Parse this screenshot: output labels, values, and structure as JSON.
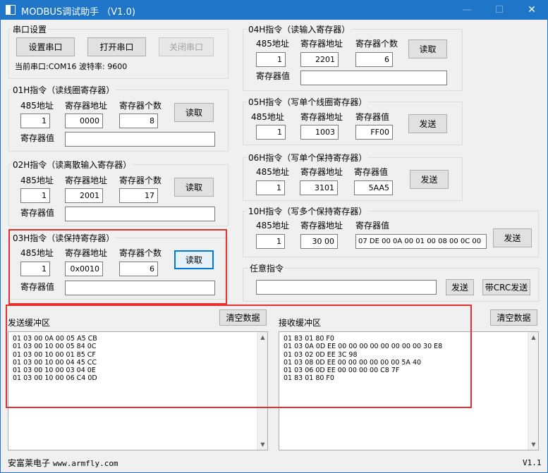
{
  "window": {
    "title": "MODBUS调试助手 （V1.0)",
    "minimize_glyph": "—",
    "maximize_glyph": "☐",
    "close_glyph": "✕"
  },
  "serial": {
    "group_label": "串口设置",
    "setup_button": "设置串口",
    "open_button": "打开串口",
    "close_button": "关闭串口",
    "status": "当前串口:COM16 波特率: 9600"
  },
  "cmd01": {
    "title": "01H指令（读线圈寄存器）",
    "addr_label": "485地址",
    "addr_value": "1",
    "reg_label": "寄存器地址",
    "reg_value": "0000",
    "count_label": "寄存器个数",
    "count_value": "8",
    "button": "读取",
    "value_label": "寄存器值",
    "value": ""
  },
  "cmd02": {
    "title": "02H指令（读离散输入寄存器）",
    "addr_label": "485地址",
    "addr_value": "1",
    "reg_label": "寄存器地址",
    "reg_value": "2001",
    "count_label": "寄存器个数",
    "count_value": "17",
    "button": "读取",
    "value_label": "寄存器值",
    "value": ""
  },
  "cmd03": {
    "title": "03H指令（读保持寄存器）",
    "addr_label": "485地址",
    "addr_value": "1",
    "reg_label": "寄存器地址",
    "reg_value": "0x0010",
    "count_label": "寄存器个数",
    "count_value": "6",
    "button": "读取",
    "value_label": "寄存器值",
    "value": ""
  },
  "cmd04": {
    "title": "04H指令（读输入寄存器）",
    "addr_label": "485地址",
    "addr_value": "1",
    "reg_label": "寄存器地址",
    "reg_value": "2201",
    "count_label": "寄存器个数",
    "count_value": "6",
    "button": "读取",
    "value_label": "寄存器值",
    "value": ""
  },
  "cmd05": {
    "title": "05H指令（写单个线圈寄存器）",
    "addr_label": "485地址",
    "addr_value": "1",
    "reg_label": "寄存器地址",
    "reg_value": "1003",
    "val_label": "寄存器值",
    "val_value": "FF00",
    "button": "发送"
  },
  "cmd06": {
    "title": "06H指令（写单个保持寄存器）",
    "addr_label": "485地址",
    "addr_value": "1",
    "reg_label": "寄存器地址",
    "reg_value": "3101",
    "val_label": "寄存器值",
    "val_value": "5AA5",
    "button": "发送"
  },
  "cmd10": {
    "title": "10H指令（写多个保持寄存器）",
    "addr_label": "485地址",
    "addr_value": "1",
    "reg_label": "寄存器地址",
    "reg_value": "30 00",
    "val_label": "寄存器值",
    "val_value": "07 DE  00 0A  00 01  00 08  00 0C  00",
    "button": "发送"
  },
  "custom": {
    "title": "任意指令",
    "value": "",
    "send_button": "发送",
    "send_crc_button": "带CRC发送"
  },
  "send_buffer": {
    "label": "发送缓冲区",
    "clear_button": "清空数据",
    "lines": [
      "01 03 00 0A 00 05 A5 CB",
      "01 03 00 10 00 05 84 0C",
      "01 03 00 10 00 01 85 CF",
      "01 03 00 10 00 04 45 CC",
      "01 03 00 10 00 03 04 0E",
      "01 03 00 10 00 06 C4 0D"
    ]
  },
  "recv_buffer": {
    "label": "接收缓冲区",
    "clear_button": "清空数据",
    "lines": [
      "01 83 01 80 F0",
      "01 03 0A 0D EE 00 00 00 00 00 00 00 00 30 E8",
      "01 03 02 0D EE 3C 98",
      "01 03 08 0D EE 00 00 00 00 00 00 5A 40",
      "01 03 06 0D EE 00 00 00 00 C8 7F",
      "01 83 01 80 F0"
    ]
  },
  "footer": {
    "company": "安富莱电子",
    "url": "www.armfly.com",
    "version": "V1.1"
  },
  "icons": {
    "scroll_up": "▲",
    "scroll_down": "▼"
  },
  "colors": {
    "titlebar": "#1f76c8",
    "highlight_box": "#e53030"
  }
}
